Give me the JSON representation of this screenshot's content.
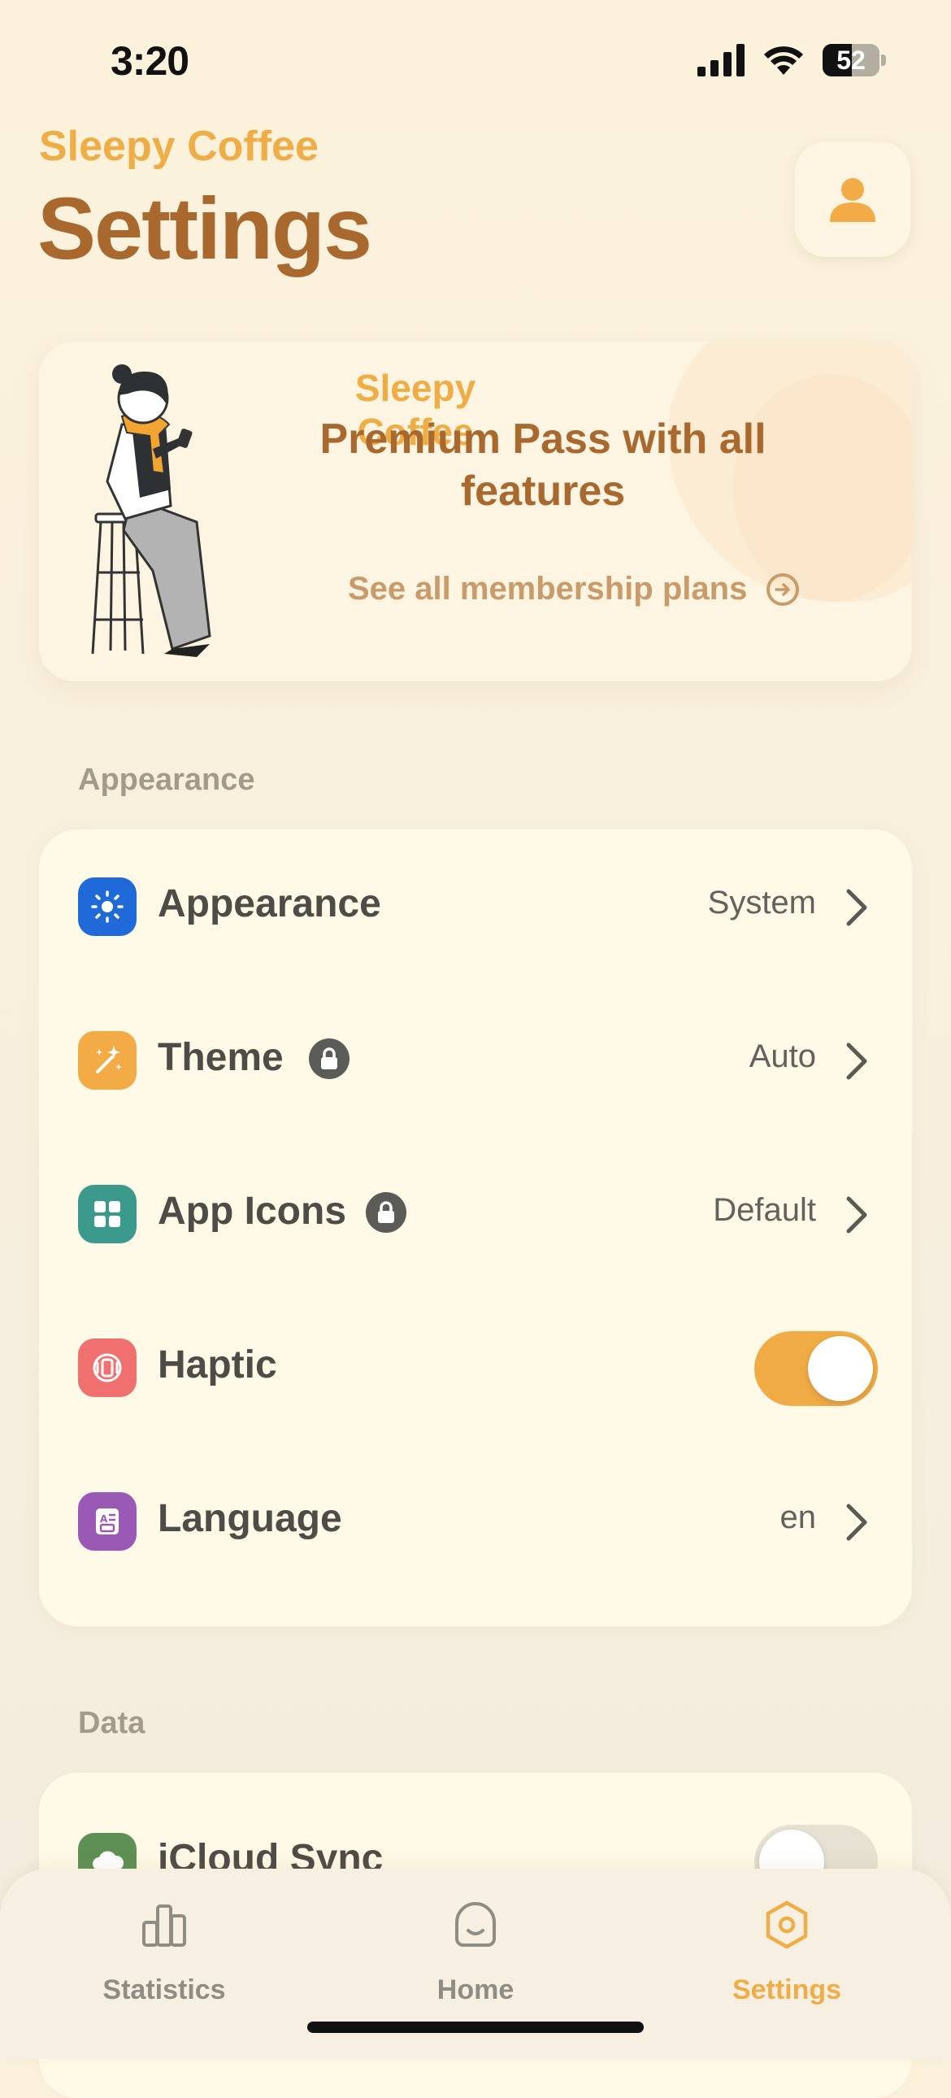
{
  "status_bar": {
    "time": "3:20",
    "battery": "52",
    "battery_fraction": 0.52
  },
  "header": {
    "app_name": "Sleepy Coffee",
    "title": "Settings",
    "profile_icon": "person-icon"
  },
  "promo": {
    "brand": "Sleepy Coffee",
    "headline": "Premium Pass with all features",
    "link_label": "See all membership plans",
    "link_icon": "arrow-right-circle-icon"
  },
  "sections": {
    "appearance": {
      "header": "Appearance",
      "rows": [
        {
          "label": "Appearance",
          "value": "System",
          "icon": "sun-icon",
          "icon_color": "#1f6ad8",
          "locked": false
        },
        {
          "label": "Theme",
          "value": "Auto",
          "icon": "sparkle-wand-icon",
          "icon_color": "#f2ab45",
          "locked": true
        },
        {
          "label": "App Icons",
          "value": "Default",
          "icon": "grid-icon",
          "icon_color": "#3b9a8c",
          "locked": true
        },
        {
          "label": "Haptic",
          "toggle": true,
          "icon": "vibration-icon",
          "icon_color": "#f07070"
        },
        {
          "label": "Language",
          "value": "en",
          "icon": "translate-icon",
          "icon_color": "#9b59b6"
        }
      ]
    },
    "data": {
      "header": "Data",
      "rows": [
        {
          "label": "iCloud Sync",
          "toggle": false,
          "icon": "cloud-icon",
          "icon_color": "#5e8f54"
        }
      ]
    }
  },
  "tab_bar": {
    "tabs": [
      {
        "label": "Statistics",
        "icon": "bar-chart-icon",
        "active": false
      },
      {
        "label": "Home",
        "icon": "home-face-icon",
        "active": false
      },
      {
        "label": "Settings",
        "icon": "hexagon-settings-icon",
        "active": true
      }
    ]
  },
  "colors": {
    "accent": "#f0ad45",
    "title_brown": "#a9682e",
    "card_bg": "#fff9e7"
  }
}
